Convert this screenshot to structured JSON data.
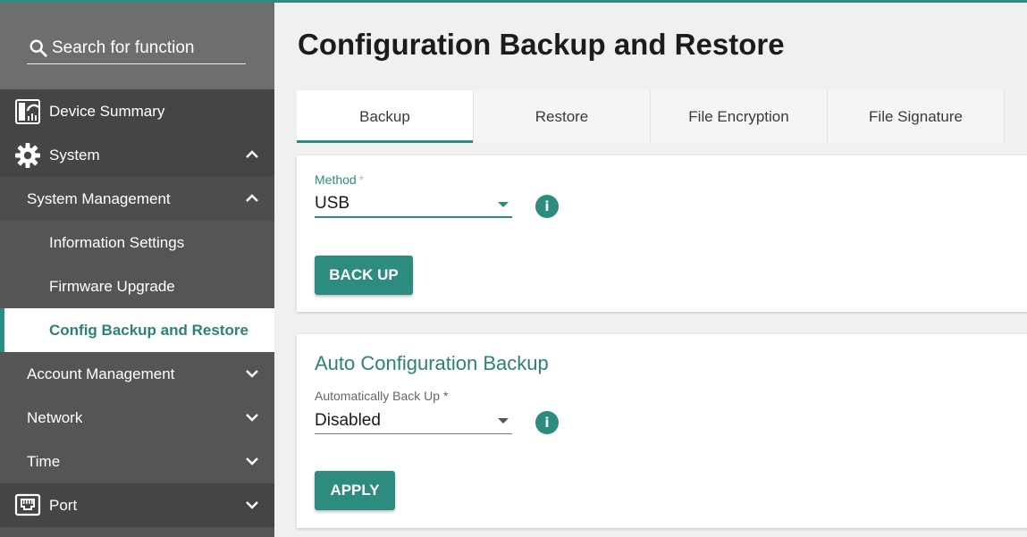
{
  "search": {
    "placeholder": "Search for function"
  },
  "sidebar": {
    "items": [
      {
        "label": "Device Summary",
        "icon": "dashboard-icon"
      },
      {
        "label": "System",
        "icon": "gear-icon"
      },
      {
        "label": "System Management"
      },
      {
        "label": "Information Settings"
      },
      {
        "label": "Firmware Upgrade"
      },
      {
        "label": "Config Backup and Restore"
      },
      {
        "label": "Account Management"
      },
      {
        "label": "Network"
      },
      {
        "label": "Time"
      },
      {
        "label": "Port",
        "icon": "ethernet-port-icon"
      }
    ]
  },
  "main": {
    "title": "Configuration Backup and Restore",
    "tabs": [
      {
        "label": "Backup"
      },
      {
        "label": "Restore"
      },
      {
        "label": "File Encryption"
      },
      {
        "label": "File Signature"
      }
    ],
    "backup": {
      "method_label": "Method",
      "method_required": "*",
      "method_value": "USB",
      "button_label": "BACK UP"
    },
    "auto": {
      "title": "Auto Configuration Backup",
      "field_label": "Automatically Back Up *",
      "field_value": "Disabled",
      "button_label": "APPLY"
    }
  },
  "colors": {
    "accent": "#2e8b80",
    "sidebar_bg": "#555555",
    "sidebar_header": "#454545"
  }
}
